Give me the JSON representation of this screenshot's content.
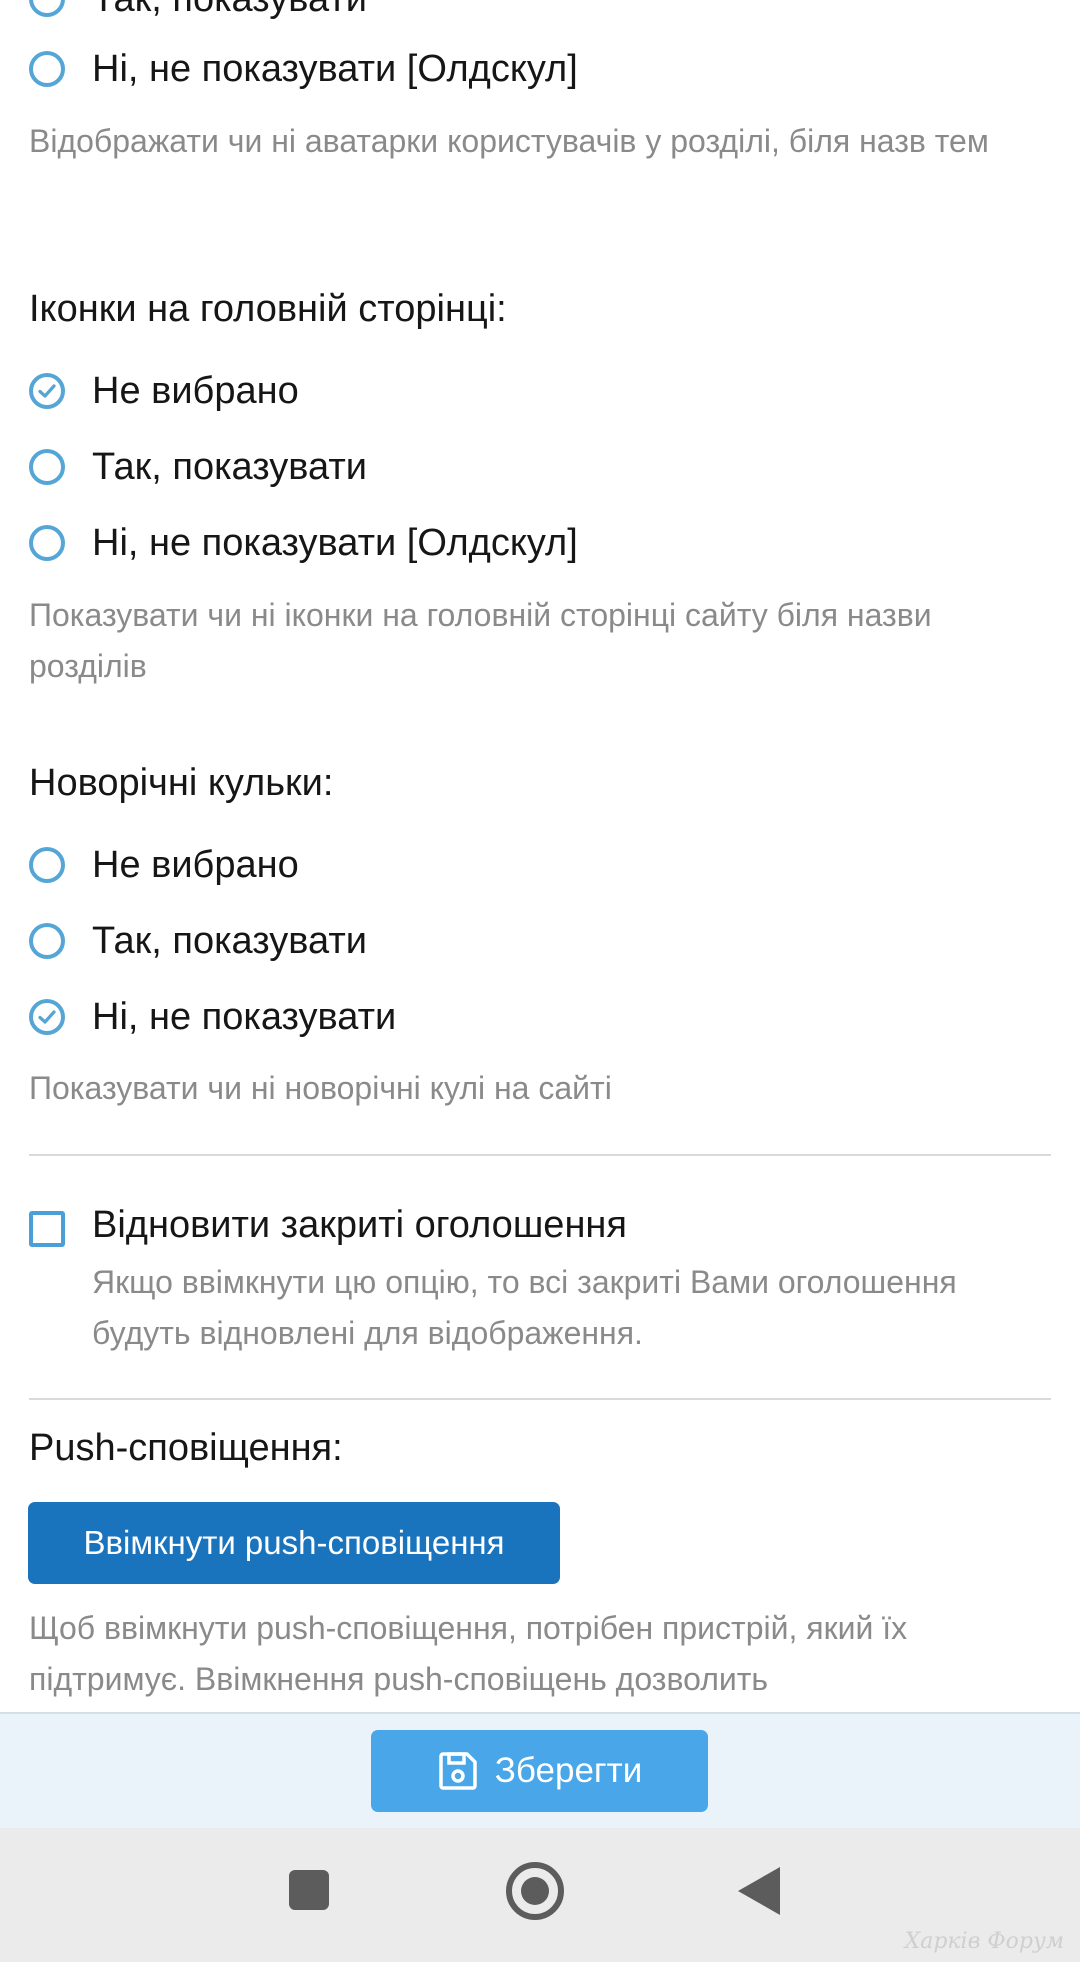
{
  "avatars_group": {
    "options": [
      "Так, показувати",
      "Ні, не показувати [Олдскул]"
    ],
    "hint": "Відображати чи ні аватарки користувачів у розділі, біля назв тем"
  },
  "icons_group": {
    "heading": "Іконки на головній сторінці:",
    "options": [
      "Не вибрано",
      "Так, показувати",
      "Ні, не показувати [Олдскул]"
    ],
    "selected": 0,
    "hint": "Показувати чи ні іконки на головній сторінці сайту біля назви розділів"
  },
  "balls_group": {
    "heading": "Новорічні кульки:",
    "options": [
      "Не вибрано",
      "Так, показувати",
      "Ні, не показувати"
    ],
    "selected": 2,
    "hint": "Показувати чи ні новорічні кулі на сайті"
  },
  "restore_ads": {
    "label": "Відновити закриті оголошення",
    "description": "Якщо ввімкнути цю опцію, то всі закриті Вами оголошення будуть відновлені для відображення.",
    "checked": false
  },
  "push": {
    "heading": "Push-сповіщення:",
    "button_label": "Ввімкнути push-сповіщення",
    "hint": "Щоб ввімкнути push-сповіщення, потрібен пристрій, який їх підтримує. Ввімкнення push-сповіщень дозволить"
  },
  "save_bar": {
    "label": "Зберегти",
    "icon": "floppy-disk-icon"
  },
  "system_nav": {
    "icons": [
      "recents-square-icon",
      "home-circle-icon",
      "back-triangle-icon"
    ]
  },
  "watermark": "Харків Форум",
  "colors": {
    "radio_accent": "#55a6d6",
    "primary_button": "#1a74bd",
    "save_button": "#49a6e8",
    "hint_text": "#8a8a8a"
  }
}
